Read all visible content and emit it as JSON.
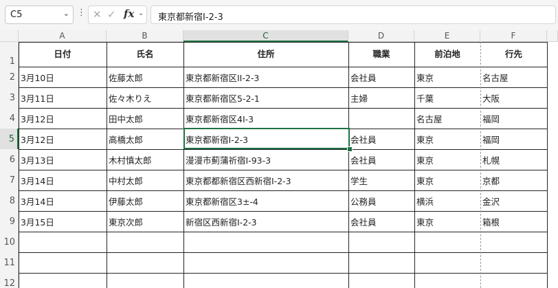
{
  "formula_bar": {
    "name_box": "C5",
    "formula": "東京都新宿I-2-3",
    "fx_label": "fx"
  },
  "columns": [
    "A",
    "B",
    "C",
    "D",
    "E",
    "F"
  ],
  "active_column": "C",
  "rows": [
    "1",
    "2",
    "3",
    "4",
    "5",
    "6",
    "7",
    "8",
    "9",
    "10",
    "11",
    "12"
  ],
  "active_row": "5",
  "table_headers": [
    "日付",
    "氏名",
    "住所",
    "職業",
    "前泊地",
    "行先"
  ],
  "table_rows": [
    [
      "3月10日",
      "佐藤太郎",
      "東京都新宿区II-2-3",
      "会社員",
      "東京",
      "名古屋"
    ],
    [
      "3月11日",
      "佐々木りえ",
      "東京都新宿区5-2-1",
      "主婦",
      "千葉",
      "大阪"
    ],
    [
      "3月12日",
      "田中太郎",
      "東京都新宿区4I-3",
      "",
      "名古屋",
      "福岡"
    ],
    [
      "3月12日",
      "高橋太郎",
      "東京都新宿I-2-3",
      "会社員",
      "東京",
      "福岡"
    ],
    [
      "3月13日",
      "木村慎太郎",
      "漫漫市薊蒲祈宿I-93-3",
      "会社員",
      "東京",
      "札幌"
    ],
    [
      "3月14日",
      "中村太郎",
      "東京都都新宿区西新宿I-2-3",
      "学生",
      "東京",
      "京都"
    ],
    [
      "3月14日",
      "伊藤太郎",
      "東京都新宿区3±-4",
      "公務員",
      "横浜",
      "金沢"
    ],
    [
      "3月15日",
      "東京次郎",
      "新宿区西新宿I-2-3",
      "会社員",
      "東京",
      "箱根"
    ]
  ],
  "colors": {
    "selection": "#1e7145",
    "header_bg": "#f3f3f3"
  },
  "icons": [
    "chevron-down-icon",
    "more-icon",
    "cancel-icon",
    "enter-icon",
    "fx-icon"
  ]
}
